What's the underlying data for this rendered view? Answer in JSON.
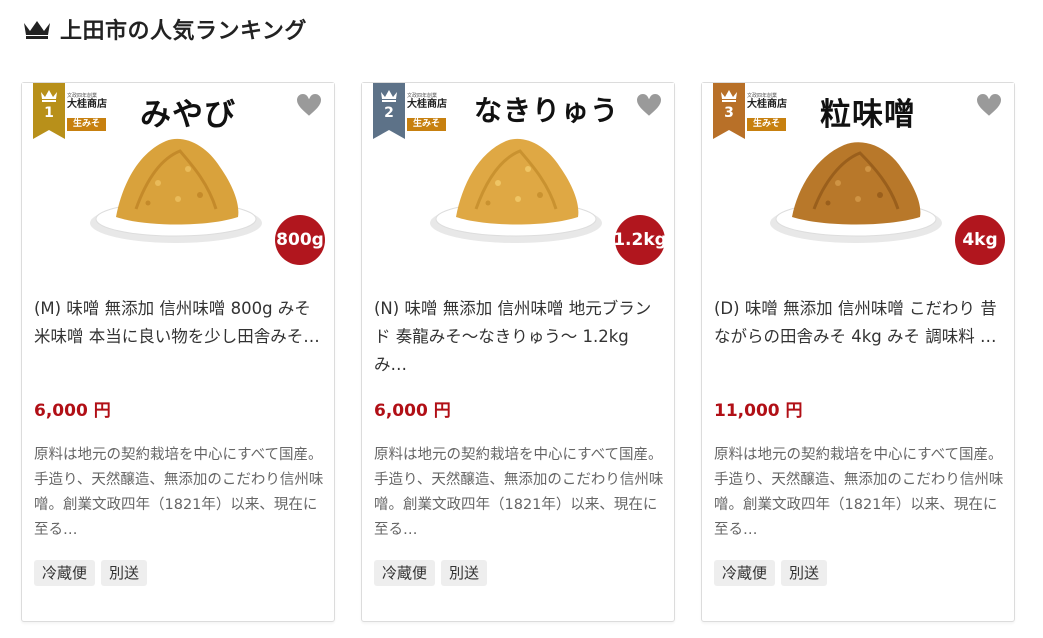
{
  "header": {
    "title": "上田市の人気ランキング"
  },
  "cards": [
    {
      "rank": "1",
      "rank_color": "#b8901a",
      "brand_small": "文政四年創業",
      "brand_name": "大桂商店",
      "brand_tag": "生みそ",
      "name_art": "みやび",
      "size": "800g",
      "title": "(M) 味噌 無添加 信州味噌 800g みそ 米味噌 本当に良い物を少し田舎みそ…",
      "price": "6,000 円",
      "description": "原料は地元の契約栽培を中心にすべて国産。手造り、天然醸造、無添加のこだわり信州味噌。創業文政四年（1821年）以来、現在に至る…",
      "tags": [
        "冷蔵便",
        "別送"
      ]
    },
    {
      "rank": "2",
      "rank_color": "#5d7288",
      "brand_small": "文政四年創業",
      "brand_name": "大桂商店",
      "brand_tag": "生みそ",
      "name_art": "なきりゅう",
      "size": "1.2kg",
      "title": "(N) 味噌 無添加 信州味噌 地元ブランド 奏龍みそ〜なきりゅう〜 1.2kg み…",
      "price": "6,000 円",
      "description": "原料は地元の契約栽培を中心にすべて国産。手造り、天然醸造、無添加のこだわり信州味噌。創業文政四年（1821年）以来、現在に至る…",
      "tags": [
        "冷蔵便",
        "別送"
      ]
    },
    {
      "rank": "3",
      "rank_color": "#b87028",
      "brand_small": "文政四年創業",
      "brand_name": "大桂商店",
      "brand_tag": "生みそ",
      "name_art": "粒味噌",
      "size": "4kg",
      "title": "(D) 味噌 無添加 信州味噌 こだわり 昔ながらの田舎みそ 4kg みそ 調味料 …",
      "price": "11,000 円",
      "description": "原料は地元の契約栽培を中心にすべて国産。手造り、天然醸造、無添加のこだわり信州味噌。創業文政四年（1821年）以来、現在に至る…",
      "tags": [
        "冷蔵便",
        "別送"
      ]
    }
  ],
  "colors": {
    "price": "#b10f16",
    "size_badge": "#b1161e",
    "miso_light": "#d9a23c",
    "miso_dark": "#b8782a"
  }
}
